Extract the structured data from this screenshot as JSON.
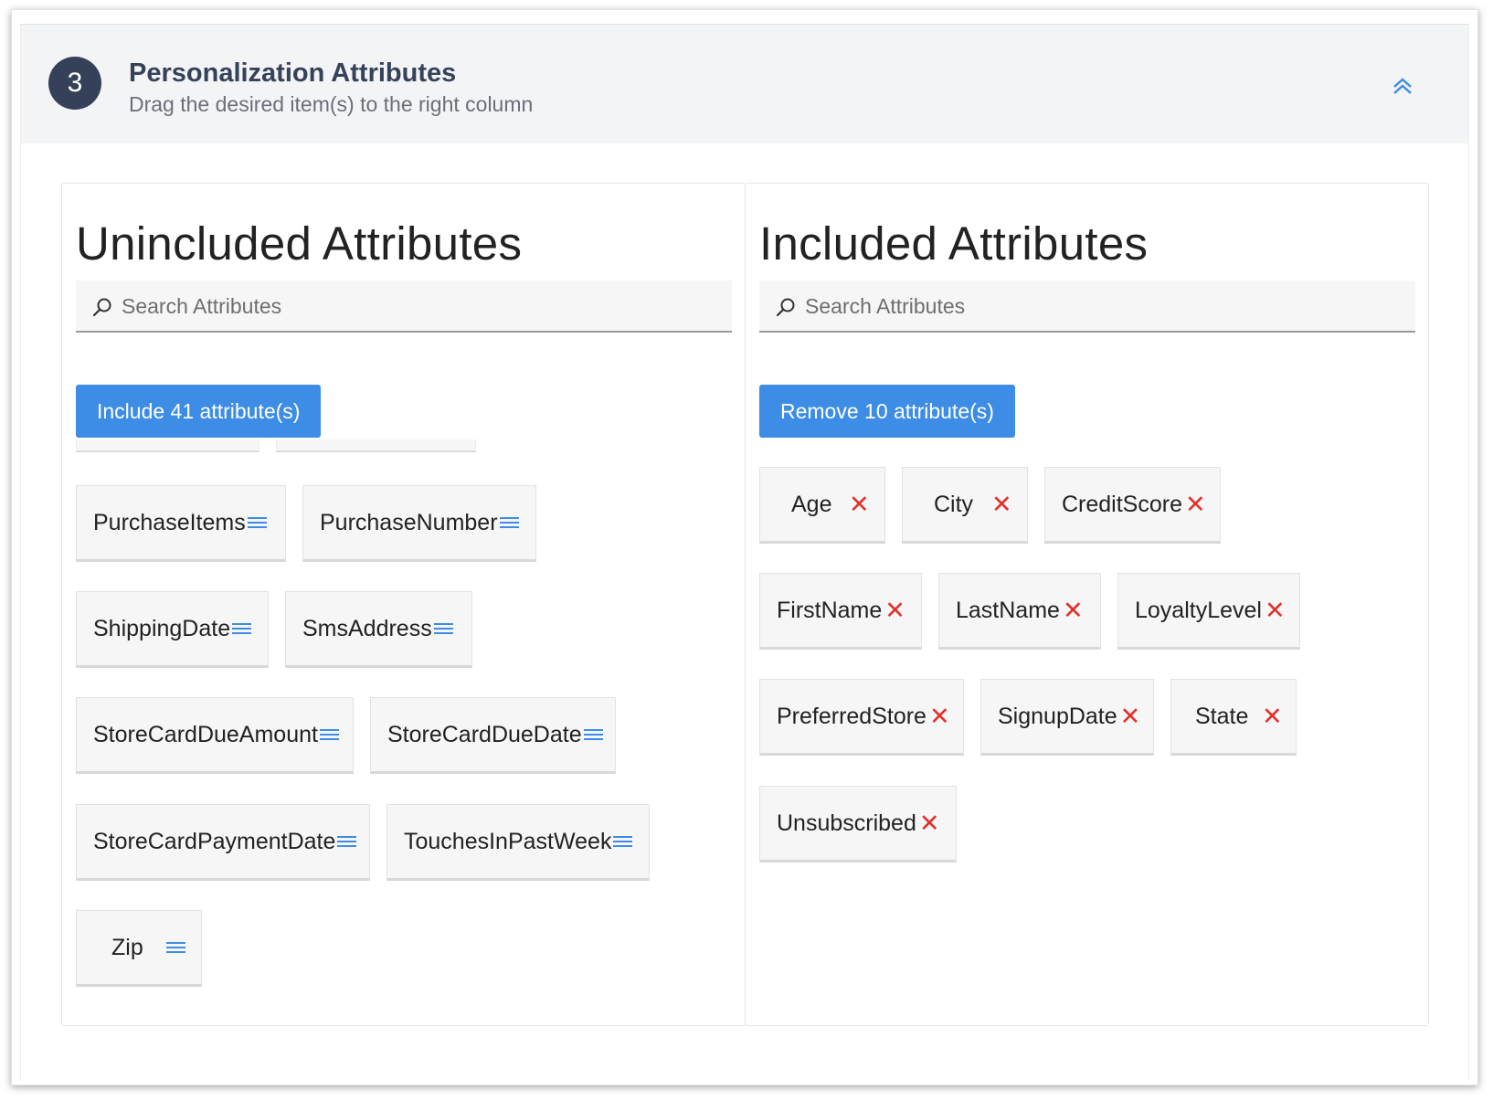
{
  "section": {
    "step_number": "3",
    "title": "Personalization Attributes",
    "subtitle": "Drag the desired item(s) to the right column",
    "collapse_icon": "double-chevron-up-icon"
  },
  "unincluded": {
    "title": "Unincluded Attributes",
    "search_placeholder": "Search Attributes",
    "action_label": "Include 41 attribute(s)",
    "items": [
      "PurchaseItems",
      "PurchaseNumber",
      "ShippingDate",
      "SmsAddress",
      "StoreCardDueAmount",
      "StoreCardDueDate",
      "StoreCardPaymentDate",
      "TouchesInPastWeek",
      "Zip"
    ]
  },
  "included": {
    "title": "Included Attributes",
    "search_placeholder": "Search Attributes",
    "action_label": "Remove 10 attribute(s)",
    "items": [
      "Age",
      "City",
      "CreditScore",
      "FirstName",
      "LastName",
      "LoyaltyLevel",
      "PreferredStore",
      "SignupDate",
      "State",
      "Unsubscribed"
    ]
  },
  "colors": {
    "accent": "#3d8ce6",
    "badge": "#354158",
    "remove": "#e0312a"
  }
}
